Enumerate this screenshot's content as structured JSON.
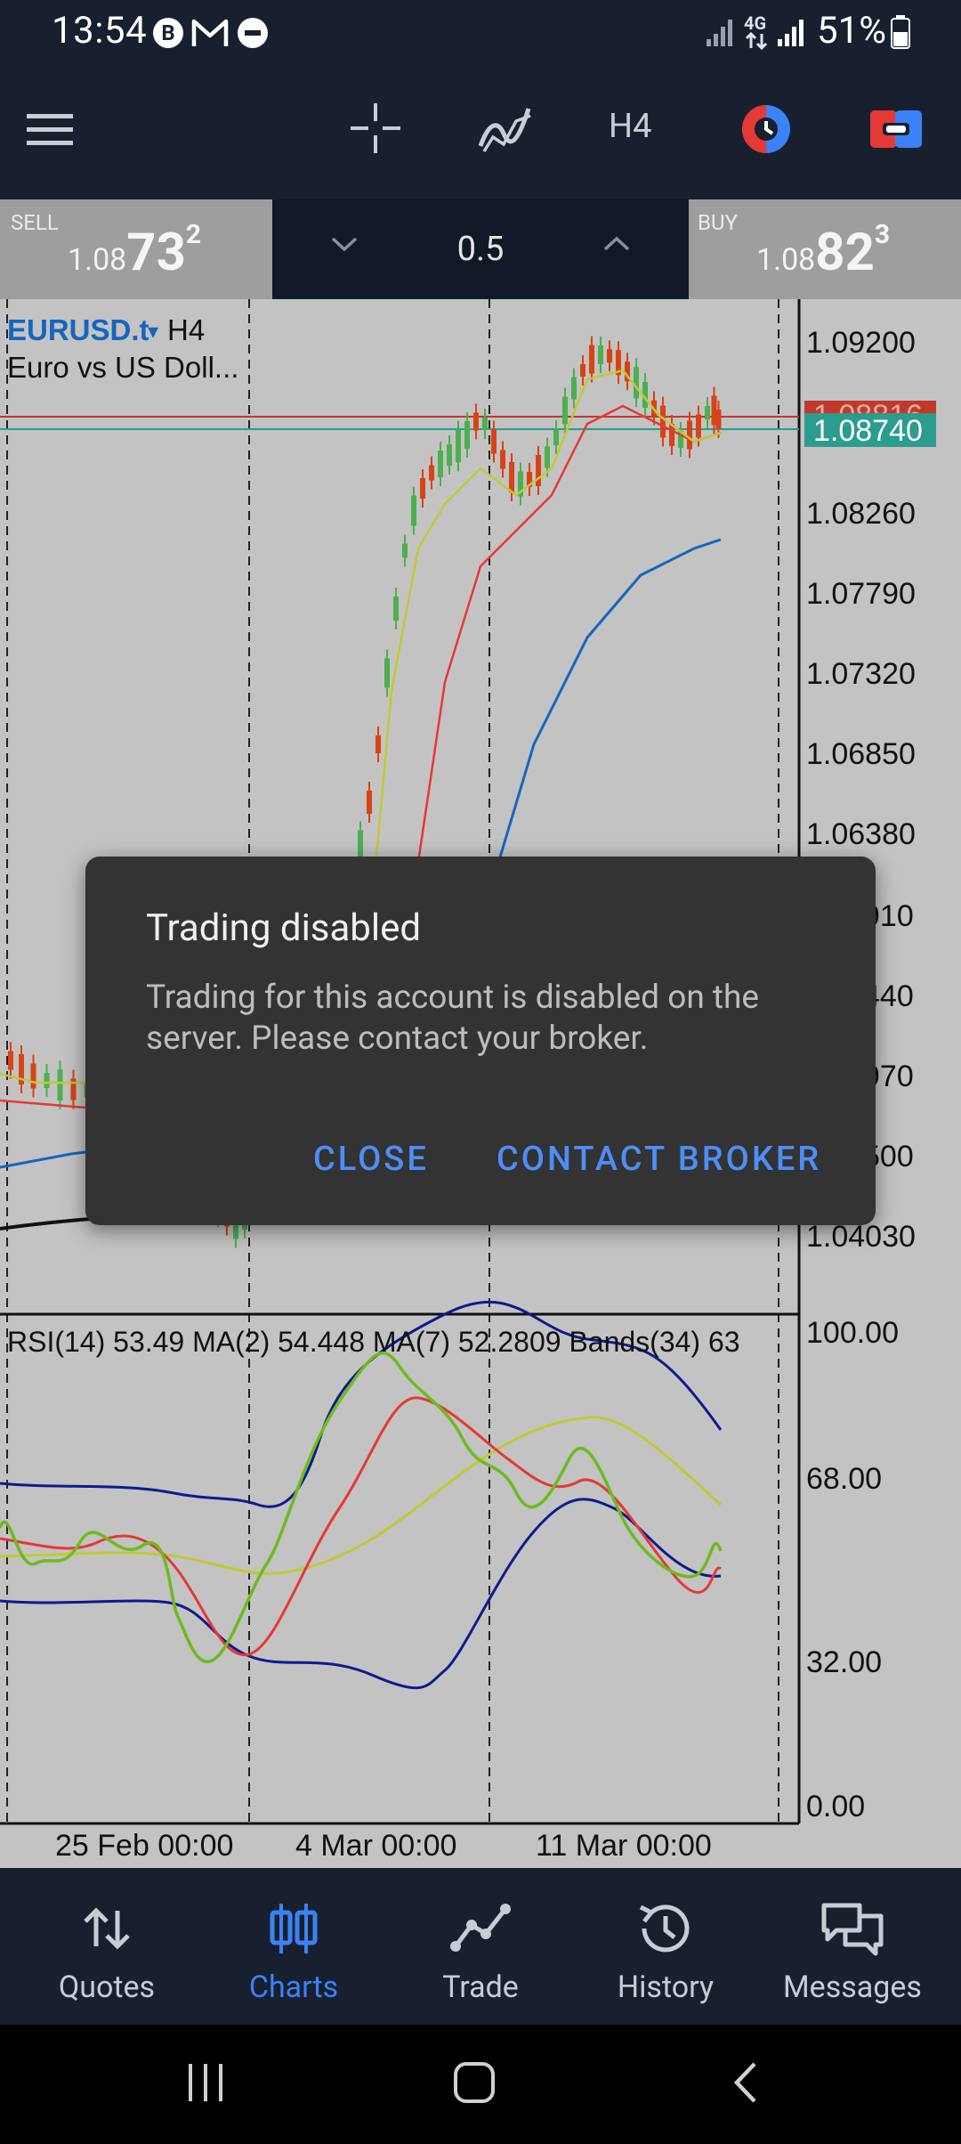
{
  "status_bar": {
    "time": "13:54",
    "notification_icons": [
      "b-circle-icon",
      "gmail-icon",
      "dnd-icon"
    ],
    "network": "4G",
    "battery": "51%"
  },
  "toolbar": {
    "timeframe": "H4",
    "icons": [
      "menu-icon",
      "crosshair-icon",
      "indicators-icon",
      "timeframe-button",
      "color-scheme-icon",
      "trade-toggle-icon"
    ]
  },
  "trade_bar": {
    "sell": {
      "label": "SELL",
      "price_prefix": "1.08",
      "price_big": "73",
      "price_sup": "2"
    },
    "volume": "0.5",
    "buy": {
      "label": "BUY",
      "price_prefix": "1.08",
      "price_big": "82",
      "price_sup": "3"
    }
  },
  "chart": {
    "symbol": "EURUSD.t",
    "symbol_arrow": "▾",
    "timeframe": "H4",
    "description": "Euro vs US Doll...",
    "current_price_label": "1.08740",
    "hidden_price_label": "1.08816",
    "price_axis": [
      "1.09200",
      "1.08260",
      "1.07790",
      "1.07320",
      "1.06850",
      "1.06380",
      "910",
      "440",
      "970",
      "500",
      "1.04030"
    ],
    "rsi_title": "RSI(14) 53.49 MA(2) 54.448 MA(7) 52.2809 Bands(34) 63",
    "rsi_axis": [
      "100.00",
      "68.00",
      "32.00",
      "0.00"
    ],
    "time_axis": [
      "25 Feb 00:00",
      "4 Mar 00:00",
      "11 Mar 00:00"
    ],
    "colors": {
      "background": "#c3c3c3",
      "bull_candle": "#4caf50",
      "bear_candle": "#d84315",
      "ma_fast": "#c0ca33",
      "ma_mid": "#e53935",
      "ma_slow": "#1565c0",
      "current_price": "#2a9d8f"
    }
  },
  "dialog": {
    "title": "Trading disabled",
    "message": "Trading for this account is disabled on the server. Please contact your broker.",
    "close_label": "CLOSE",
    "contact_label": "CONTACT BROKER"
  },
  "bottom_nav": {
    "items": [
      {
        "label": "Quotes",
        "icon": "quotes-icon",
        "active": false
      },
      {
        "label": "Charts",
        "icon": "charts-icon",
        "active": true
      },
      {
        "label": "Trade",
        "icon": "trade-icon",
        "active": false
      },
      {
        "label": "History",
        "icon": "history-icon",
        "active": false
      },
      {
        "label": "Messages",
        "icon": "messages-icon",
        "active": false
      }
    ]
  },
  "system_nav": [
    "recents-button",
    "home-button",
    "back-button"
  ]
}
